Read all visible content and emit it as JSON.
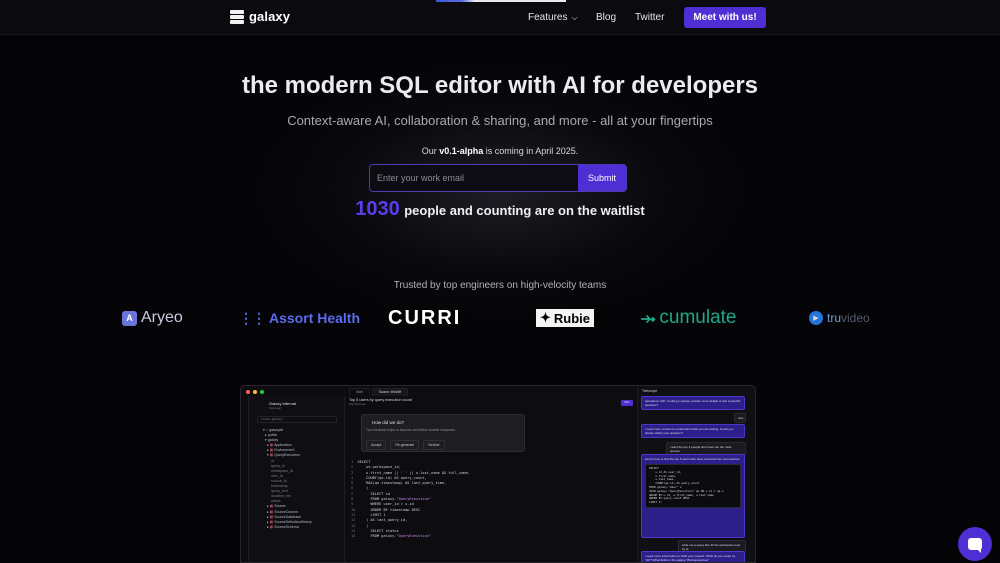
{
  "header": {
    "logo_text": "galaxy",
    "nav": {
      "features_label": "Features",
      "blog_label": "Blog",
      "twitter_label": "Twitter"
    },
    "cta_label": "Meet with us!"
  },
  "hero": {
    "title": "the modern SQL editor with AI for developers",
    "subtitle": "Context-aware AI, collaboration & sharing, and more - all at your fingertips",
    "release_prefix": "Our ",
    "release_version": "v0.1-alpha",
    "release_suffix": " is coming in April 2025.",
    "email_placeholder": "Enter your work email",
    "submit_label": "Submit",
    "waitlist_count": "1030",
    "waitlist_text": "people and counting are on the waitlist"
  },
  "trusted": {
    "heading": "Trusted by top engineers on high-velocity teams",
    "brands": {
      "aryeo": "Aryeo",
      "assort": "Assort Health",
      "curri": "CURRI",
      "rubie": "Rubie",
      "cumulate": "cumulate",
      "truvideo_a": "tru",
      "truvideo_b": "video"
    }
  },
  "app_preview": {
    "project_name": "Galaxy Internal",
    "project_sub": "Personal",
    "search_placeholder": "local-galaxy",
    "tabs": [
      "Start",
      "Source: bf4cf4ff"
    ],
    "query_title": "Top 5 users by query execution count",
    "query_sub": "PQ Schema",
    "run_label": "Run",
    "feedback": {
      "title": "How did we do?",
      "desc": "Your feedback helps us improve and deliver smarter responses.",
      "accept": "Accept",
      "regenerate": "Re-generate",
      "decline": "Decline"
    },
    "assist_header": "Telescope",
    "tree": [
      "galaxydb",
      "public",
      "galaxy",
      "Application",
      "Environment",
      "QueryExecution",
      "id",
      "query_id",
      "workspace_id",
      "user_id",
      "source_id",
      "timestamp",
      "query_text",
      "duration_ms",
      "status",
      "Source",
      "SourceColumn",
      "SourceDatabase",
      "SourceDefinitionHistory",
      "SourceSchema"
    ]
  },
  "colors": {
    "accent": "#4f2fd3",
    "waitlist_count": "#5a3df0",
    "background": "#050507"
  },
  "icons": {
    "chat": "chat-bubble-icon",
    "chevron": "chevron-down-icon"
  }
}
